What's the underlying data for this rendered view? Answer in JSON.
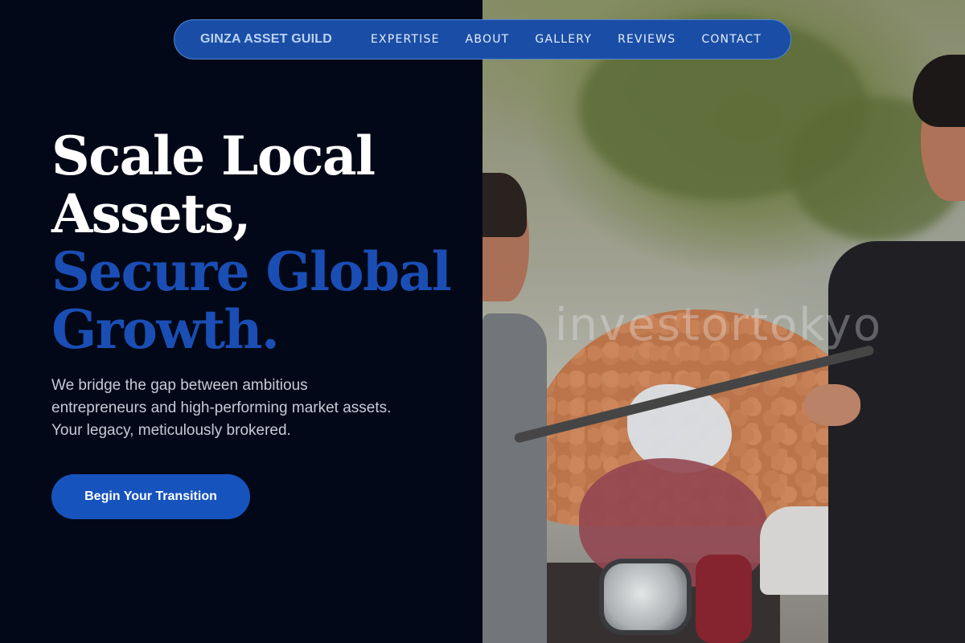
{
  "nav": {
    "brand": "GINZA ASSET GUILD",
    "links": [
      "EXPERTISE",
      "ABOUT",
      "GALLERY",
      "REVIEWS",
      "CONTACT"
    ]
  },
  "hero": {
    "headline_lines": [
      "Scale Local",
      "Assets,",
      "Secure Global",
      "Growth."
    ],
    "subtext": "We bridge the gap between ambitious entrepreneurs and high-performing market assets. Your legacy, meticulously brokered.",
    "cta_label": "Begin Your Transition"
  },
  "photo": {
    "watermark": "investortokyo"
  },
  "colors": {
    "background": "#020817",
    "nav_pill": "#1a4ea6",
    "accent_blue": "#1a4eb5",
    "cta": "#1753bd",
    "headline_white": "#ffffff"
  }
}
